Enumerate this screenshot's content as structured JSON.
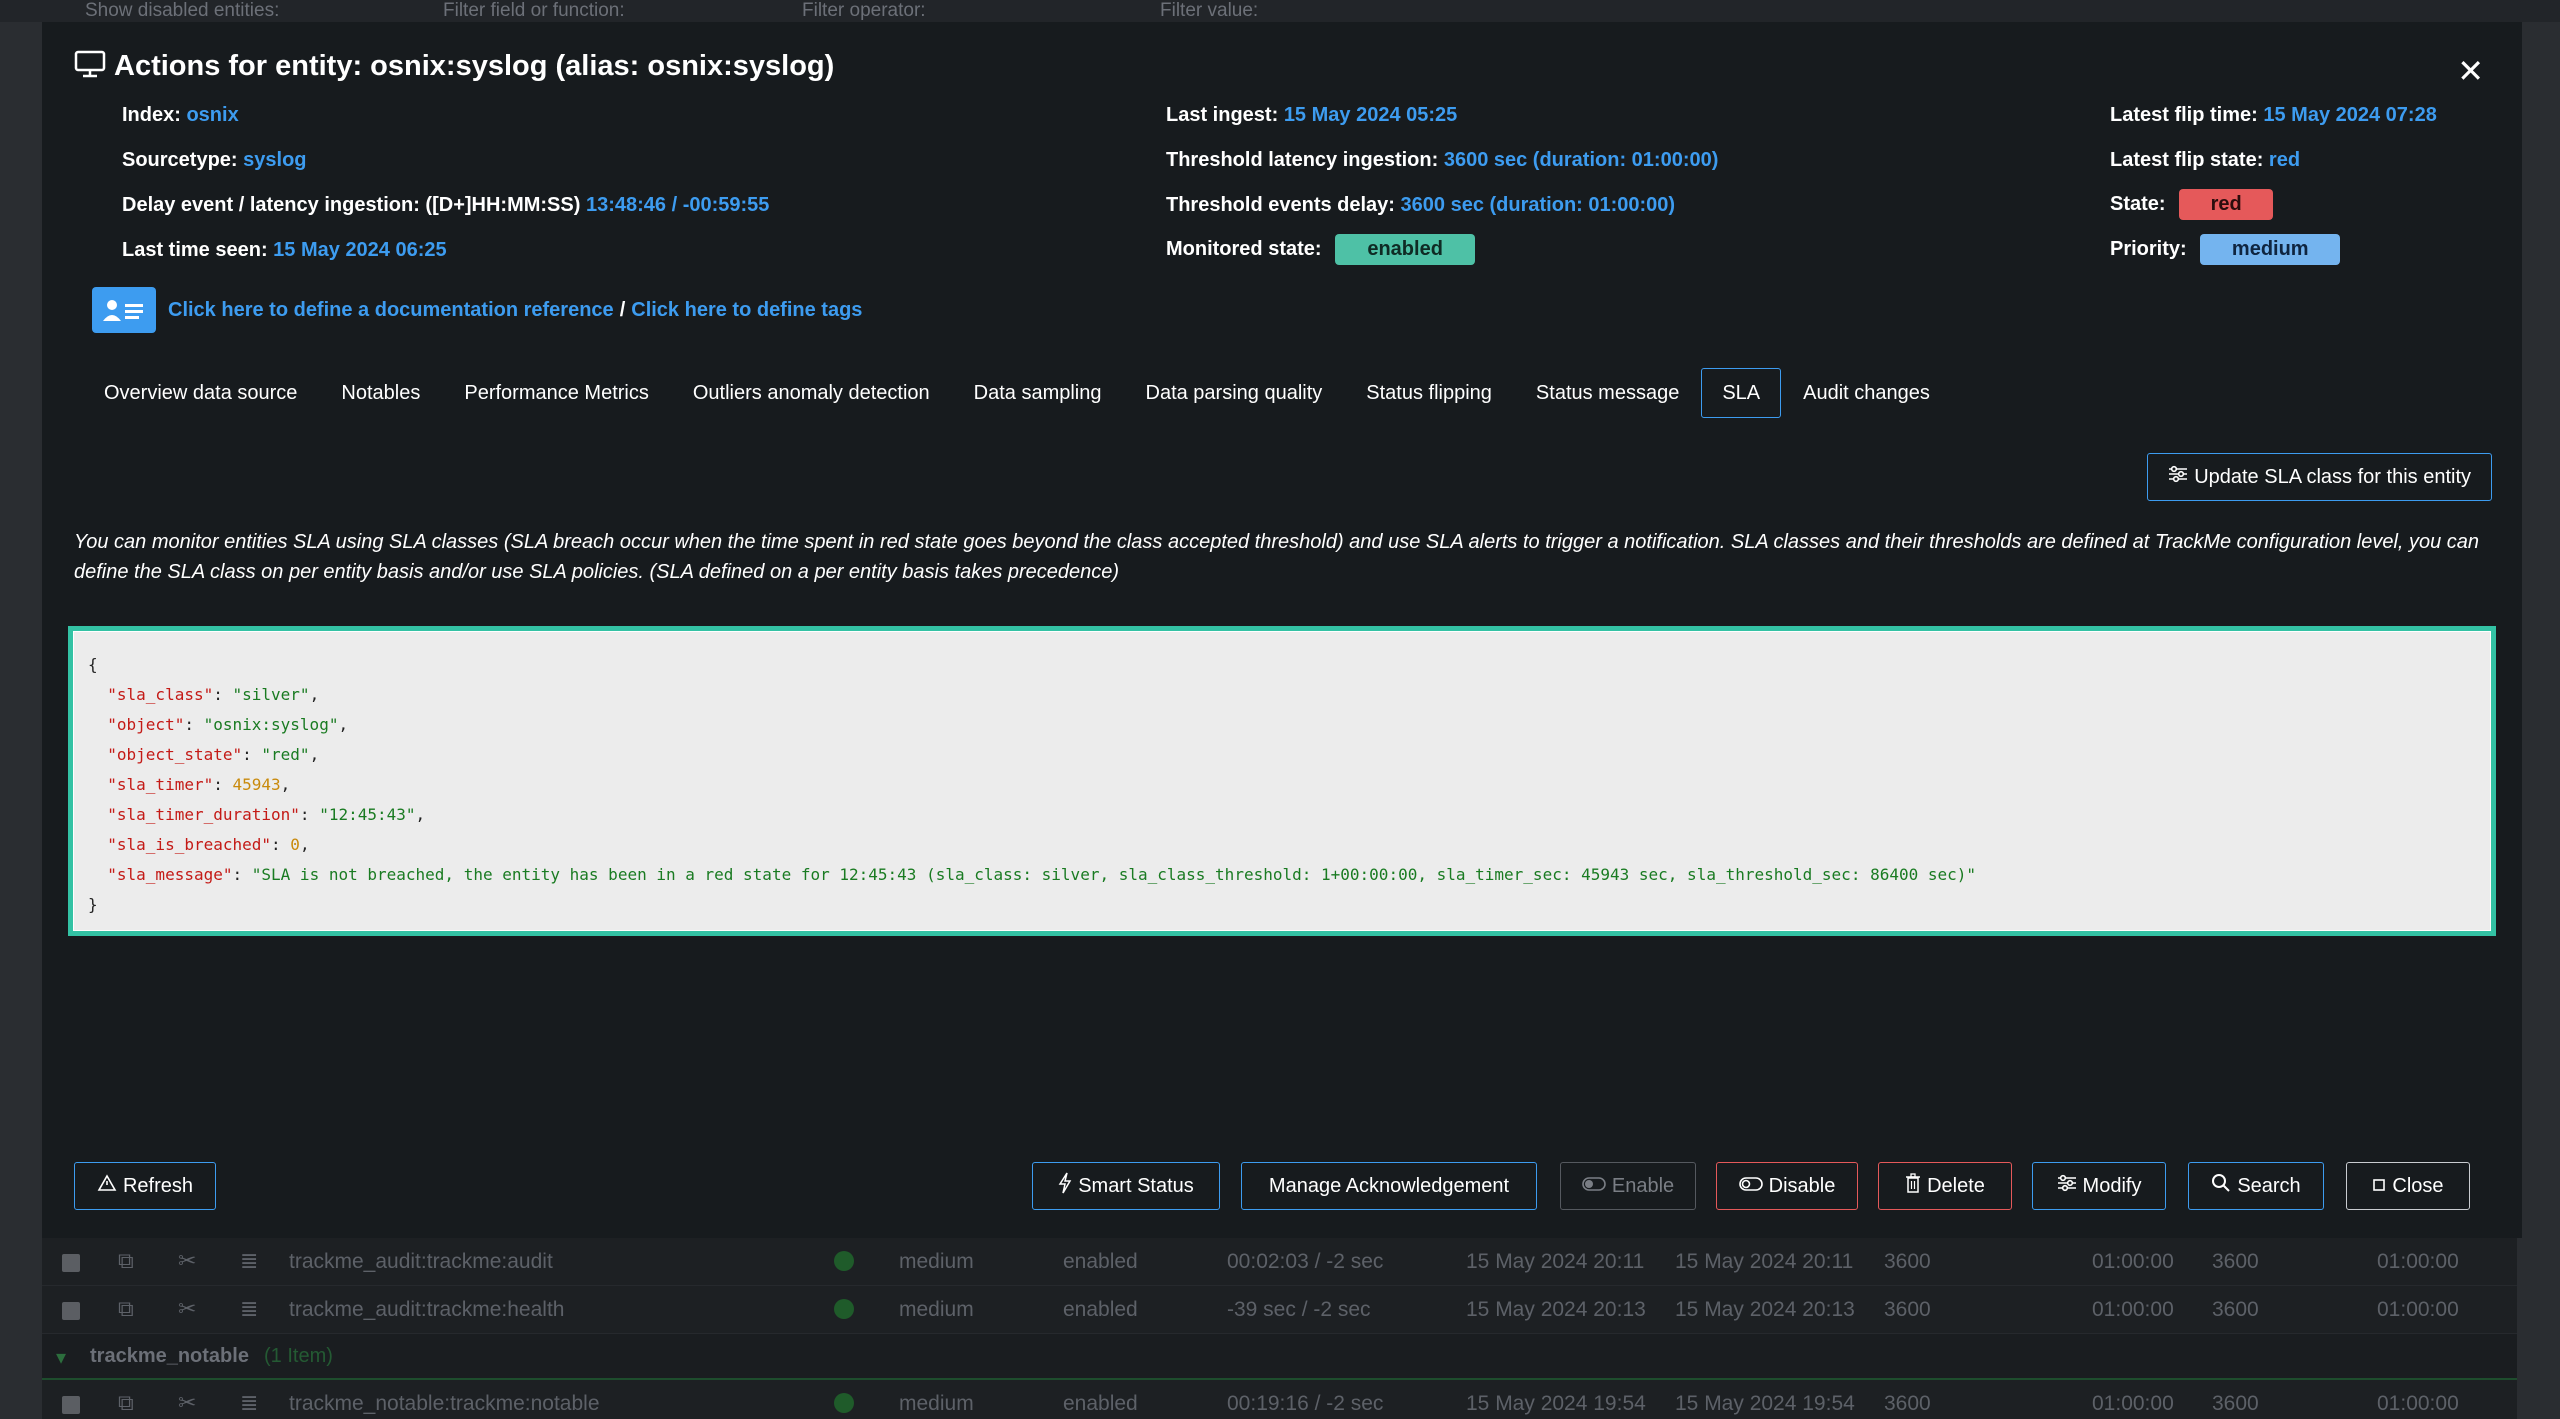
{
  "background": {
    "filters": [
      "Show disabled entities:",
      "Filter field or function:",
      "Filter operator:",
      "Filter value:"
    ],
    "rows": [
      {
        "name": "trackme_audit:trackme:audit",
        "priority": "medium",
        "state": "enabled",
        "lag": "00:02:03 / -2 sec",
        "t1": "15 May 2024 20:11",
        "t2": "15 May 2024 20:11",
        "v1": "3600",
        "v2": "01:00:00",
        "v3": "3600",
        "v4": "01:00:00"
      },
      {
        "name": "trackme_audit:trackme:health",
        "priority": "medium",
        "state": "enabled",
        "lag": "-39 sec / -2 sec",
        "t1": "15 May 2024 20:13",
        "t2": "15 May 2024 20:13",
        "v1": "3600",
        "v2": "01:00:00",
        "v3": "3600",
        "v4": "01:00:00"
      },
      {
        "name": "trackme_notable:trackme:notable",
        "priority": "medium",
        "state": "enabled",
        "lag": "00:19:16 / -2 sec",
        "t1": "15 May 2024 19:54",
        "t2": "15 May 2024 19:54",
        "v1": "3600",
        "v2": "01:00:00",
        "v3": "3600",
        "v4": "01:00:00"
      }
    ],
    "group": {
      "name": "trackme_notable",
      "count": "(1 Item)"
    }
  },
  "modal": {
    "title": "Actions for entity: osnix:syslog (alias: osnix:syslog)",
    "col1": {
      "index_label": "Index:",
      "index_value": "osnix",
      "sourcetype_label": "Sourcetype:",
      "sourcetype_value": "syslog",
      "delay_label": "Delay event / latency ingestion: ([D+]HH:MM:SS)",
      "delay_value": "13:48:46 / -00:59:55",
      "lastseen_label": "Last time seen:",
      "lastseen_value": "15 May 2024 06:25"
    },
    "col2": {
      "ingest_label": "Last ingest:",
      "ingest_value": "15 May 2024 05:25",
      "thr_lat_label": "Threshold latency ingestion:",
      "thr_lat_value": "3600 sec (duration: 01:00:00)",
      "thr_evt_label": "Threshold events delay:",
      "thr_evt_value": "3600 sec (duration: 01:00:00)",
      "monitored_label": "Monitored state:",
      "monitored_value": "enabled"
    },
    "col3": {
      "flip_time_label": "Latest flip time:",
      "flip_time_value": "15 May 2024 07:28",
      "flip_state_label": "Latest flip state:",
      "flip_state_value": "red",
      "state_label": "State:",
      "state_value": "red",
      "priority_label": "Priority:",
      "priority_value": "medium"
    },
    "doc_link": "Click here to define a documentation reference",
    "doc_sep": "/",
    "tags_link": "Click here to define tags",
    "tabs": [
      "Overview data source",
      "Notables",
      "Performance Metrics",
      "Outliers anomaly detection",
      "Data sampling",
      "Data parsing quality",
      "Status flipping",
      "Status message",
      "SLA",
      "Audit changes"
    ],
    "active_tab": "SLA",
    "update_sla_button": "Update SLA class for this entity",
    "description": "You can monitor entities SLA using SLA classes (SLA breach occur when the time spent in red state goes beyond the class accepted threshold) and use SLA alerts to trigger a notification. SLA classes and their thresholds are defined at TrackMe configuration level, you can define the SLA class on per entity basis and/or use SLA policies. (SLA defined on a per entity basis takes precedence)",
    "sla_json": [
      {
        "key": "\"sla_class\"",
        "value": "\"silver\"",
        "type": "s"
      },
      {
        "key": "\"object\"",
        "value": "\"osnix:syslog\"",
        "type": "s"
      },
      {
        "key": "\"object_state\"",
        "value": "\"red\"",
        "type": "s"
      },
      {
        "key": "\"sla_timer\"",
        "value": "45943",
        "type": "n"
      },
      {
        "key": "\"sla_timer_duration\"",
        "value": "\"12:45:43\"",
        "type": "s"
      },
      {
        "key": "\"sla_is_breached\"",
        "value": "0",
        "type": "n"
      },
      {
        "key": "\"sla_message\"",
        "value": "\"SLA is not breached, the entity has been in a red state for 12:45:43 (sla_class: silver, sla_class_threshold: 1+00:00:00, sla_timer_sec: 45943 sec, sla_threshold_sec: 86400 sec)\"",
        "type": "s"
      }
    ],
    "footer": {
      "refresh": "Refresh",
      "smart_status": "Smart Status",
      "manage_ack": "Manage Acknowledgement",
      "enable": "Enable",
      "disable": "Disable",
      "delete": "Delete",
      "modify": "Modify",
      "search": "Search",
      "close": "Close"
    }
  }
}
